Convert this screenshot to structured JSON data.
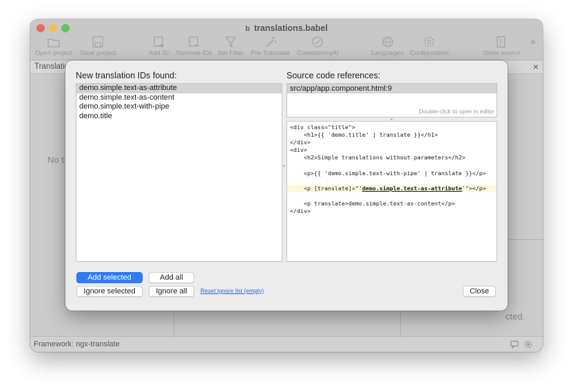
{
  "window": {
    "title": "translations.babel",
    "title_icon": "b",
    "toolbar": [
      {
        "label": "Open project",
        "icon": "folder-icon"
      },
      {
        "label": "Save project",
        "icon": "save-icon"
      },
      {
        "label": "Add ID",
        "icon": "add-id-icon"
      },
      {
        "label": "Remove IDs",
        "icon": "remove-ids-icon"
      },
      {
        "label": "Set Filter",
        "icon": "filter-icon"
      },
      {
        "label": "Pre-Translate",
        "icon": "wand-icon"
      },
      {
        "label": "ConsistencyAI",
        "icon": "consistency-icon"
      },
      {
        "label": "Languages",
        "icon": "globe-icon"
      },
      {
        "label": "Configuration",
        "icon": "gear-icon"
      },
      {
        "label": "Show source",
        "icon": "source-icon"
      }
    ],
    "subheader_label": "Translatio",
    "no_translations_text": "No t",
    "selected_hint_text": "cted.",
    "status": "Framework: ngx-translate"
  },
  "dialog": {
    "new_ids_label": "New translation IDs found:",
    "new_ids": [
      {
        "id": "demo.simple.text-as-attribute",
        "selected": true
      },
      {
        "id": "demo.simple.text-as-content",
        "selected": false
      },
      {
        "id": "demo.simple.text-with-pipe",
        "selected": false
      },
      {
        "id": "demo.title",
        "selected": false
      }
    ],
    "source_refs_label": "Source code references:",
    "source_refs": [
      "src/app/app.component.html:9"
    ],
    "open_hint": "Double-click to open in editor",
    "code_lines": [
      {
        "text": "<div class=\"title\">"
      },
      {
        "text": "    <h1>{{ 'demo.title' | translate }}</h1>"
      },
      {
        "text": "</div>"
      },
      {
        "text": "<div>"
      },
      {
        "text": "    <h2>Simple translations without parameters</h2>"
      },
      {
        "text": ""
      },
      {
        "text": "    <p>{{ 'demo.simple.text-with-pipe' | translate }}</p>"
      },
      {
        "text": ""
      },
      {
        "text": "    <p [translate]=\"'",
        "key": "demo.simple.text-as-attribute",
        "after": "'\"></p>",
        "highlight": true
      },
      {
        "text": ""
      },
      {
        "text": "    <p translate>demo.simple.text-as-content</p>"
      },
      {
        "text": "</div>"
      }
    ],
    "buttons": {
      "add_selected": "Add selected",
      "add_all": "Add all",
      "ignore_selected": "Ignore selected",
      "ignore_all": "Ignore all",
      "reset_ignore": "Reset ignore list (empty)",
      "close": "Close"
    },
    "accent_color": "#2f7cf6"
  }
}
